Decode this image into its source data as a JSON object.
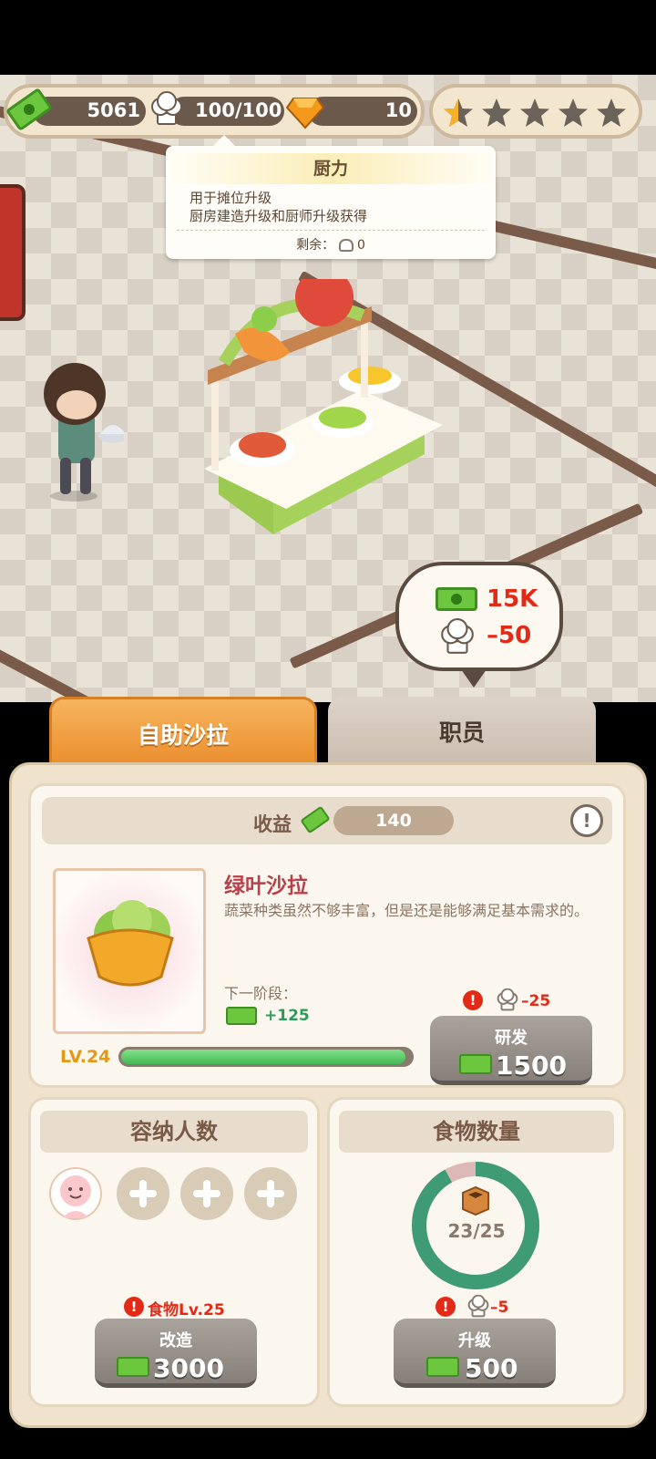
{
  "hud": {
    "cash": "5061",
    "chef_power": "100/100",
    "gems": "10",
    "stars_filled": 0.5,
    "stars_total": 5
  },
  "tooltip": {
    "title": "厨力",
    "line1": "用于摊位升级",
    "line2": "厨房建造升级和厨师升级获得",
    "remain_label": "剩余：",
    "remain_value": "0"
  },
  "cost_bubble": {
    "cash": "15K",
    "chef_power": "–50"
  },
  "tabs": [
    {
      "label": "自助沙拉",
      "active": true
    },
    {
      "label": "职员",
      "active": false
    }
  ],
  "main": {
    "income_label": "收益",
    "income_value": "140",
    "info": "!",
    "dish_name": "绿叶沙拉",
    "dish_desc": "蔬菜种类虽然不够丰富，但是还是能够满足基本需求的。",
    "next_stage_label": "下一阶段：",
    "next_stage_value": "+125",
    "level_label": "LV.24",
    "level_progress": 0.98,
    "research": {
      "requirement": "–25",
      "title": "研发",
      "cost": "1500"
    }
  },
  "capacity": {
    "title": "容纳人数",
    "seats_filled": 1,
    "seats_total": 4,
    "requirement": "食物Lv.25",
    "button_title": "改造",
    "button_cost": "3000"
  },
  "food": {
    "title": "食物数量",
    "count": "23/25",
    "fraction": 0.92,
    "requirement": "–5",
    "button_title": "升级",
    "button_cost": "500"
  },
  "colors": {
    "accent_orange": "#ea8f2e",
    "warn_red": "#e22a16",
    "ring_green": "#3f9b73",
    "progress_green": "#42b952"
  }
}
